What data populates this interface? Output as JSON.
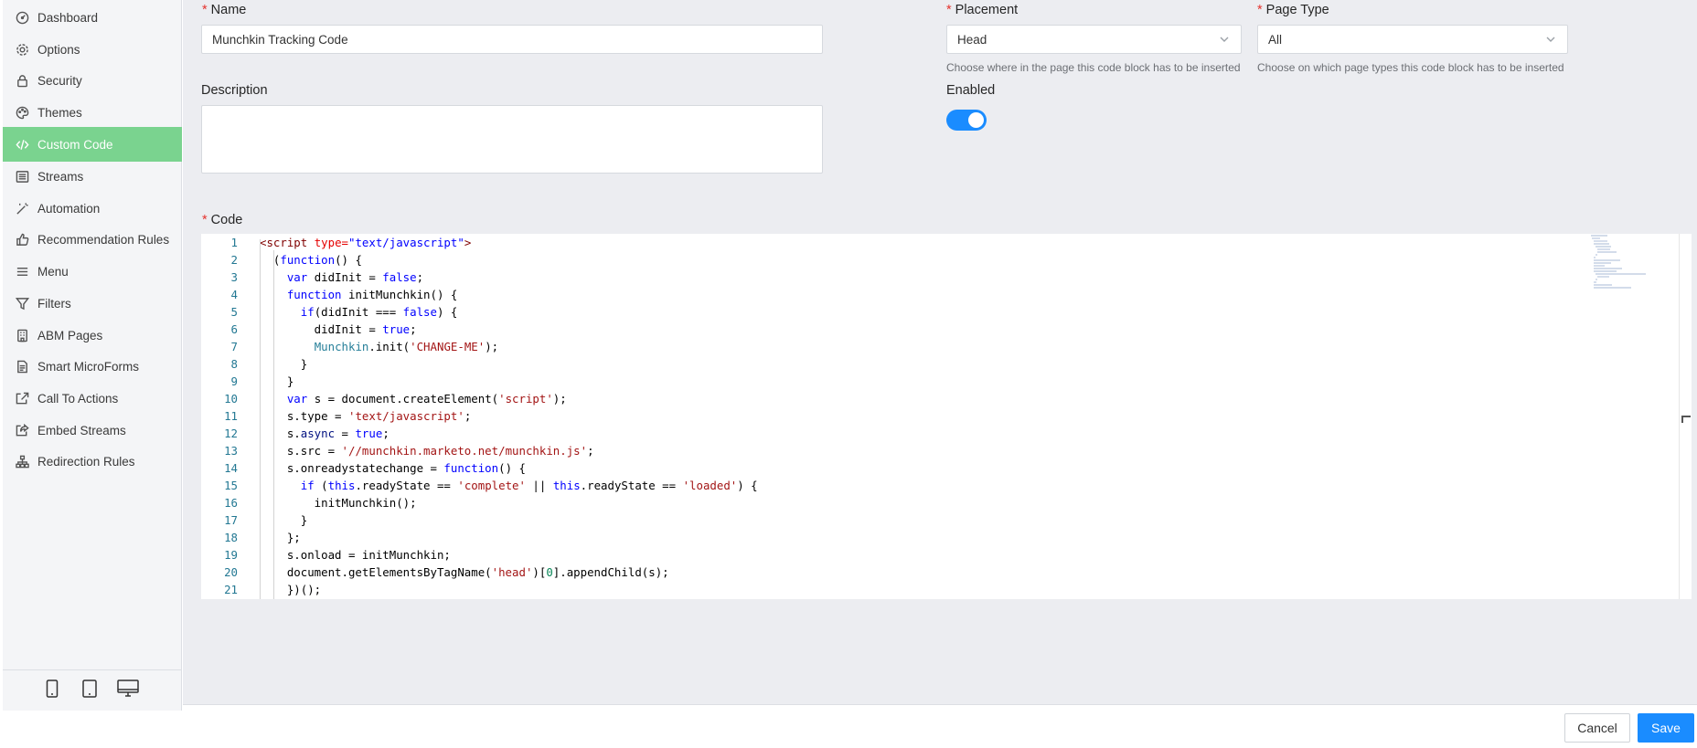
{
  "sidebar": {
    "items": [
      {
        "label": "Dashboard",
        "icon": "dashboard-icon"
      },
      {
        "label": "Options",
        "icon": "gear-icon"
      },
      {
        "label": "Security",
        "icon": "lock-icon"
      },
      {
        "label": "Themes",
        "icon": "palette-icon"
      },
      {
        "label": "Custom Code",
        "icon": "code-icon",
        "active": true
      },
      {
        "label": "Streams",
        "icon": "list-icon"
      },
      {
        "label": "Automation",
        "icon": "magic-wand-icon"
      },
      {
        "label": "Recommendation Rules",
        "icon": "thumbs-up-icon"
      },
      {
        "label": "Menu",
        "icon": "menu-icon"
      },
      {
        "label": "Filters",
        "icon": "filter-icon"
      },
      {
        "label": "ABM Pages",
        "icon": "building-icon"
      },
      {
        "label": "Smart MicroForms",
        "icon": "form-icon"
      },
      {
        "label": "Call To Actions",
        "icon": "external-link-icon"
      },
      {
        "label": "Embed Streams",
        "icon": "share-icon"
      },
      {
        "label": "Redirection Rules",
        "icon": "sitemap-icon"
      }
    ],
    "devices": [
      "mobile-icon",
      "tablet-icon",
      "desktop-icon"
    ],
    "active_color": "#7ad38f"
  },
  "form": {
    "name": {
      "label": "Name",
      "value": "Munchkin Tracking Code"
    },
    "description": {
      "label": "Description",
      "value": ""
    },
    "placement": {
      "label": "Placement",
      "value": "Head",
      "hint": "Choose where in the page this code block has to be inserted"
    },
    "page_type": {
      "label": "Page Type",
      "value": "All",
      "hint": "Choose on which page types this code block has to be inserted"
    },
    "enabled": {
      "label": "Enabled",
      "on": true
    },
    "code": {
      "label": "Code"
    },
    "required_marker": "*"
  },
  "code_lines": [
    [
      [
        "<",
        "tk-tag"
      ],
      [
        "script",
        "tk-tag"
      ],
      [
        " type=",
        "tk-attr"
      ],
      [
        "\"text/javascript\"",
        "tk-kw"
      ],
      [
        ">",
        "tk-tag"
      ]
    ],
    [
      [
        "  (",
        "tk-plain"
      ],
      [
        "function",
        "tk-kw"
      ],
      [
        "() {",
        "tk-plain"
      ]
    ],
    [
      [
        "    ",
        "tk-plain"
      ],
      [
        "var",
        "tk-kw"
      ],
      [
        " didInit = ",
        "tk-plain"
      ],
      [
        "false",
        "tk-kw"
      ],
      [
        ";",
        "tk-plain"
      ]
    ],
    [
      [
        "    ",
        "tk-plain"
      ],
      [
        "function",
        "tk-kw"
      ],
      [
        " initMunchkin() {",
        "tk-plain"
      ]
    ],
    [
      [
        "      ",
        "tk-plain"
      ],
      [
        "if",
        "tk-kw"
      ],
      [
        "(didInit === ",
        "tk-plain"
      ],
      [
        "false",
        "tk-kw"
      ],
      [
        ") {",
        "tk-plain"
      ]
    ],
    [
      [
        "        didInit = ",
        "tk-plain"
      ],
      [
        "true",
        "tk-kw"
      ],
      [
        ";",
        "tk-plain"
      ]
    ],
    [
      [
        "        ",
        "tk-plain"
      ],
      [
        "Munchkin",
        "tk-cls"
      ],
      [
        ".init(",
        "tk-plain"
      ],
      [
        "'CHANGE-ME'",
        "tk-str"
      ],
      [
        ");",
        "tk-plain"
      ]
    ],
    [
      [
        "      }",
        "tk-plain"
      ]
    ],
    [
      [
        "    }",
        "tk-plain"
      ]
    ],
    [
      [
        "    ",
        "tk-plain"
      ],
      [
        "var",
        "tk-kw"
      ],
      [
        " s = document.createElement(",
        "tk-plain"
      ],
      [
        "'script'",
        "tk-str"
      ],
      [
        ");",
        "tk-plain"
      ]
    ],
    [
      [
        "    s.type = ",
        "tk-plain"
      ],
      [
        "'text/javascript'",
        "tk-str"
      ],
      [
        ";",
        "tk-plain"
      ]
    ],
    [
      [
        "    s.",
        "tk-plain"
      ],
      [
        "async",
        "tk-prop"
      ],
      [
        " = ",
        "tk-plain"
      ],
      [
        "true",
        "tk-kw"
      ],
      [
        ";",
        "tk-plain"
      ]
    ],
    [
      [
        "    s.src = ",
        "tk-plain"
      ],
      [
        "'//munchkin.marketo.net/munchkin.js'",
        "tk-str"
      ],
      [
        ";",
        "tk-plain"
      ]
    ],
    [
      [
        "    s.onreadystatechange = ",
        "tk-plain"
      ],
      [
        "function",
        "tk-kw"
      ],
      [
        "() {",
        "tk-plain"
      ]
    ],
    [
      [
        "      ",
        "tk-plain"
      ],
      [
        "if",
        "tk-kw"
      ],
      [
        " (",
        "tk-plain"
      ],
      [
        "this",
        "tk-kw"
      ],
      [
        ".readyState == ",
        "tk-plain"
      ],
      [
        "'complete'",
        "tk-str"
      ],
      [
        " || ",
        "tk-plain"
      ],
      [
        "this",
        "tk-kw"
      ],
      [
        ".readyState == ",
        "tk-plain"
      ],
      [
        "'loaded'",
        "tk-str"
      ],
      [
        ") {",
        "tk-plain"
      ]
    ],
    [
      [
        "        initMunchkin();",
        "tk-plain"
      ]
    ],
    [
      [
        "      }",
        "tk-plain"
      ]
    ],
    [
      [
        "    };",
        "tk-plain"
      ]
    ],
    [
      [
        "    s.onload = initMunchkin;",
        "tk-plain"
      ]
    ],
    [
      [
        "    document.getElementsByTagName(",
        "tk-plain"
      ],
      [
        "'head'",
        "tk-str"
      ],
      [
        ")[",
        "tk-plain"
      ],
      [
        "0",
        "tk-num"
      ],
      [
        "].appendChild(s);",
        "tk-plain"
      ]
    ],
    [
      [
        "    })();",
        "tk-plain"
      ]
    ]
  ],
  "footer": {
    "cancel_label": "Cancel",
    "save_label": "Save"
  },
  "colors": {
    "primary": "#1a8cff",
    "required": "#e5322d"
  }
}
